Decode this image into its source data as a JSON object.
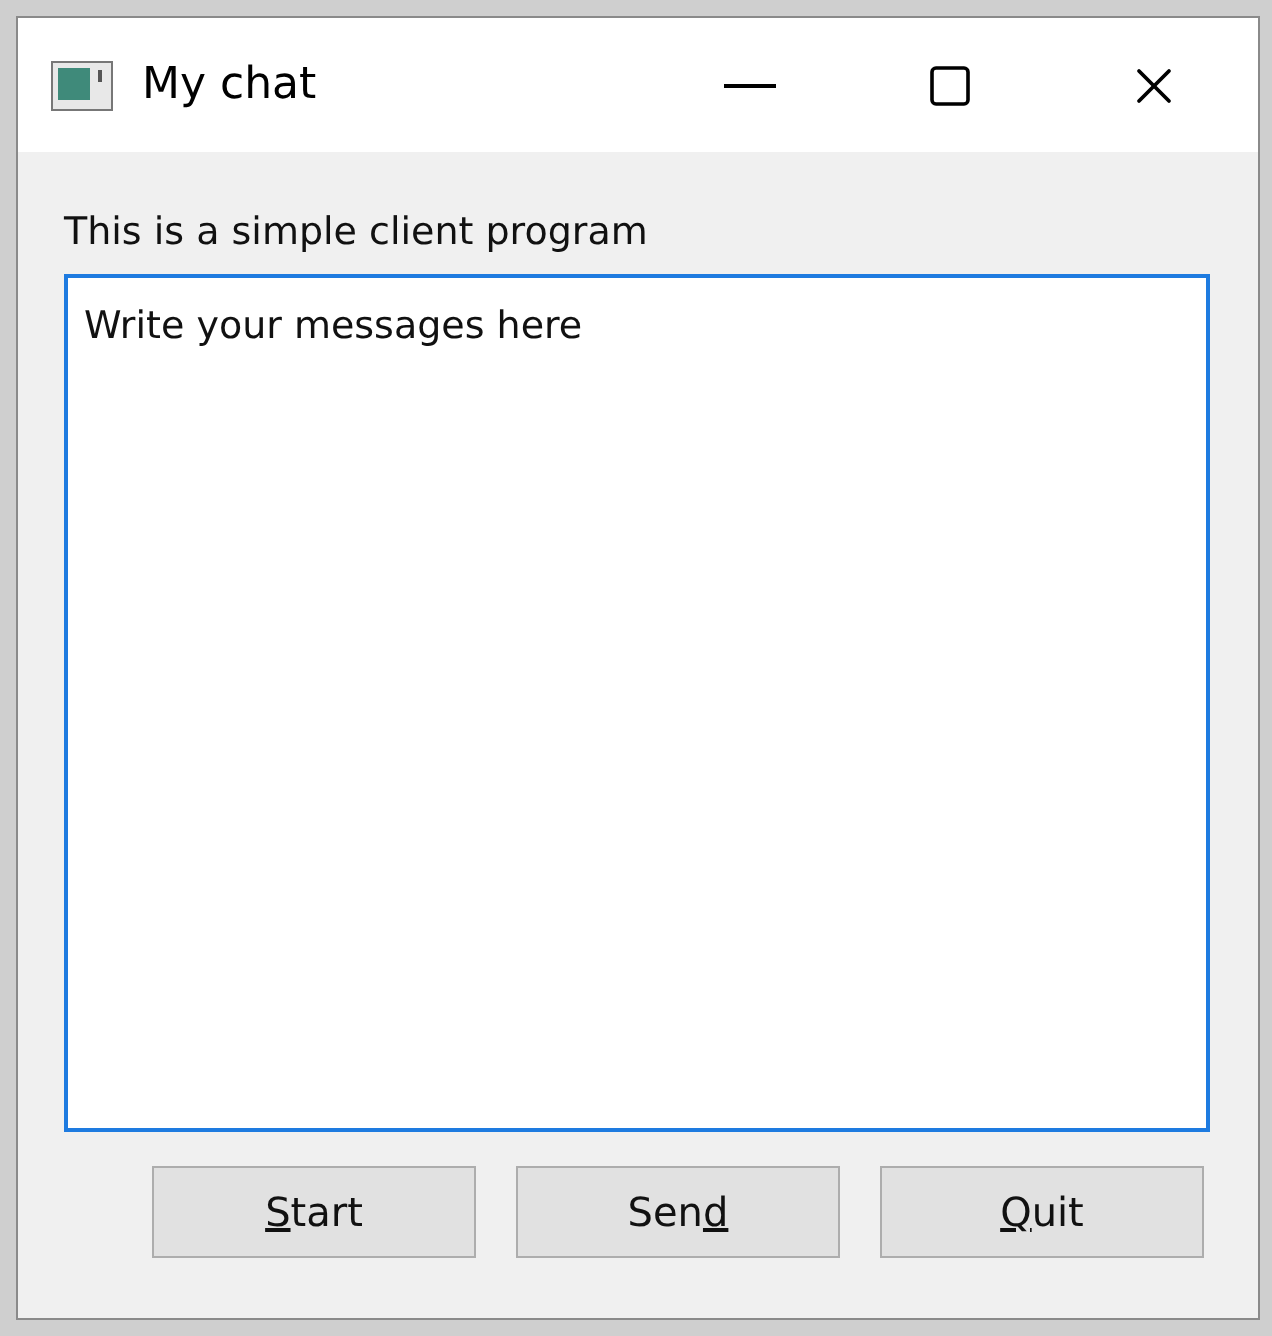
{
  "window": {
    "title": "My chat"
  },
  "label": "This is a simple client program",
  "message_field": {
    "value": "Write your messages here",
    "focused": true
  },
  "buttons": [
    {
      "key": "S",
      "post": "tart"
    },
    {
      "pre": "Sen",
      "key": "d"
    },
    {
      "key": "Q",
      "post": "uit"
    }
  ]
}
